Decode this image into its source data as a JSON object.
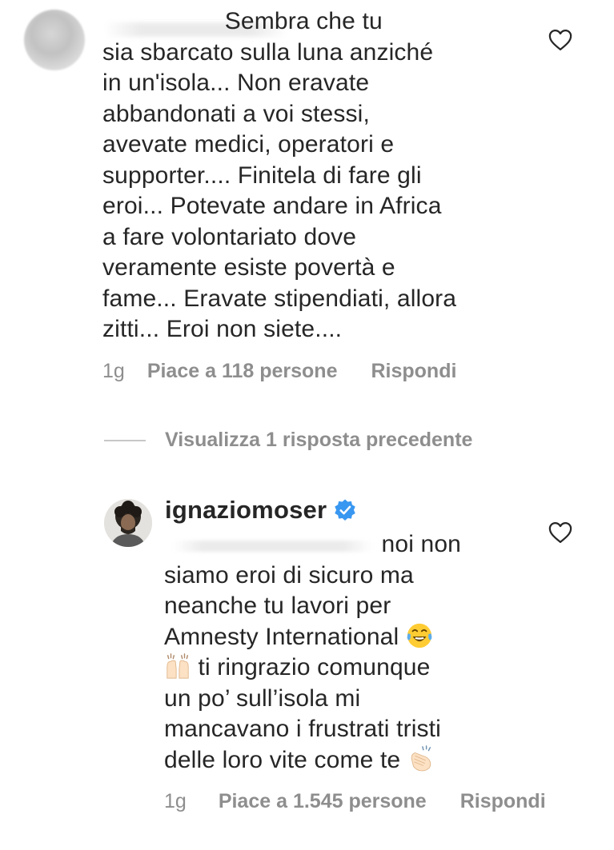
{
  "comment": {
    "lines": [
      "                  Sembra che tu",
      "sia sbarcato sulla luna anziché",
      "in un'isola... Non eravate",
      "abbandonati a voi stessi,",
      "avevate medici, operatori e",
      "supporter.... Finitela di fare gli",
      "eroi... Potevate andare in Africa",
      "a fare volontariato dove",
      "veramente esiste povertà e",
      "fame... Eravate stipendiati, allora",
      "zitti... Eroi non siete...."
    ],
    "age": "1g",
    "likes": "Piace a 118 persone",
    "reply_label": "Rispondi"
  },
  "view_replies": {
    "label": "Visualizza 1 risposta precedente"
  },
  "reply": {
    "username": "ignaziomoser",
    "lines": [
      "                                noi non",
      "siamo eroi di sicuro ma",
      "neanche tu lavori per",
      "Amnesty International",
      "ti ringrazio comunque",
      "un po’ sull’isola mi",
      "mancavano i frustrati tristi",
      "delle loro vite come te"
    ],
    "emojis": [
      "laughing-tears-emoji",
      "raised-hands-emoji",
      "clapping-hands-emoji"
    ],
    "age": "1g",
    "likes": "Piace a 1.545 persone",
    "reply_label": "Rispondi"
  },
  "colors": {
    "text": "#262626",
    "secondary": "#8e8e8e",
    "verified": "#3897f0",
    "divider": "#c7c7c7"
  }
}
